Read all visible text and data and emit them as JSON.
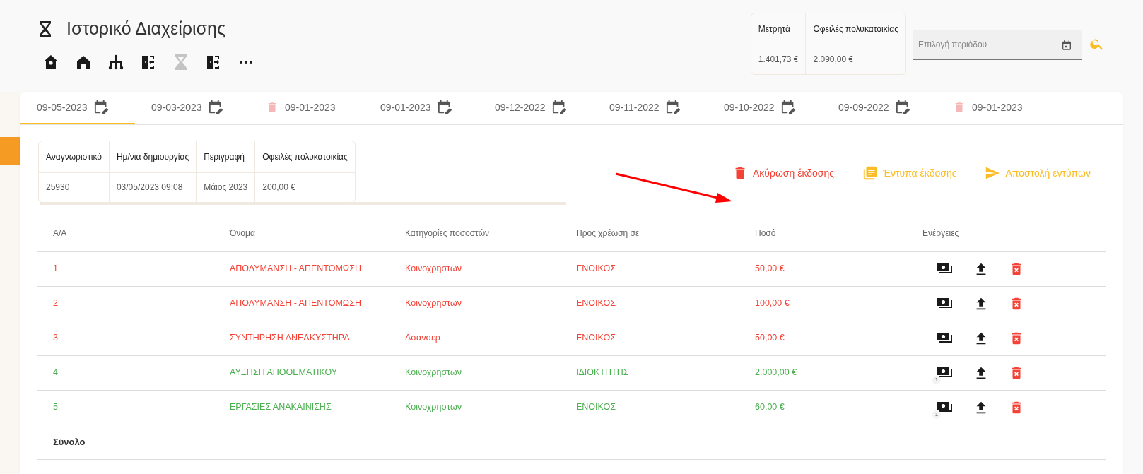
{
  "header": {
    "title": "Ιστορικό Διαχείρισης"
  },
  "toolbar": [
    {
      "kind": "building",
      "selected": false
    },
    {
      "kind": "home",
      "selected": false
    },
    {
      "kind": "tree",
      "selected": false
    },
    {
      "kind": "door-in",
      "selected": false
    },
    {
      "kind": "hourglass",
      "selected": true
    },
    {
      "kind": "door-out",
      "selected": false
    },
    {
      "kind": "more",
      "selected": false
    }
  ],
  "summary": {
    "columns": [
      "Μετρητά",
      "Οφειλές πολυκατοικίας"
    ],
    "values": [
      "1.401,73 €",
      "2.090,00 €"
    ]
  },
  "period_field": {
    "placeholder": "Επιλογή περιόδου"
  },
  "tabs": [
    {
      "label": "09-05-2023",
      "kind": "edit",
      "selected": true
    },
    {
      "label": "09-03-2023",
      "kind": "edit",
      "selected": false
    },
    {
      "label": "09-01-2023",
      "kind": "cancelled",
      "selected": false
    },
    {
      "label": "09-01-2023",
      "kind": "edit",
      "selected": false
    },
    {
      "label": "09-12-2022",
      "kind": "edit",
      "selected": false
    },
    {
      "label": "09-11-2022",
      "kind": "edit",
      "selected": false
    },
    {
      "label": "09-10-2022",
      "kind": "edit",
      "selected": false
    },
    {
      "label": "09-09-2022",
      "kind": "edit",
      "selected": false
    },
    {
      "label": "09-01-2023",
      "kind": "cancelled",
      "selected": false
    }
  ],
  "issue_info": {
    "columns": [
      "Αναγνωριστικό",
      "Ημ/νια δημιουργίας",
      "Περιγραφή",
      "Οφειλές πολυκατοικίας"
    ],
    "values": [
      "25930",
      "03/05/2023 09:08",
      "Μάιος 2023",
      "200,00 €"
    ]
  },
  "actions": [
    {
      "label": "Ακύρωση έκδοσης",
      "kind": "cancel"
    },
    {
      "label": "Έντυπα έκδοσης",
      "kind": "pdf"
    },
    {
      "label": "Αποστολή εντύπων",
      "kind": "send"
    }
  ],
  "table": {
    "columns": [
      "Α/Α",
      "Όνομα",
      "Κατηγορίες ποσοστών",
      "Προς χρέωση σε",
      "Ποσό",
      "Ενέργειες"
    ],
    "rows": [
      {
        "cells": [
          "1",
          "ΑΠΟΛΥΜΑΝΣΗ - ΑΠΕΝΤΟΜΩΣΗ",
          "Κοινοχρηστων",
          "ΕΝΟΙΚΟΣ",
          "50,00 €"
        ],
        "color": "#f44336"
      },
      {
        "cells": [
          "2",
          "ΑΠΟΛΥΜΑΝΣΗ - ΑΠΕΝΤΟΜΩΣΗ",
          "Κοινοχρηστων",
          "ΕΝΟΙΚΟΣ",
          "100,00 €"
        ],
        "color": "#f44336"
      },
      {
        "cells": [
          "3",
          "ΣΥΝΤΗΡΗΣΗ ΑΝΕΛΚΥΣΤΗΡΑ",
          "Ασανσερ",
          "ΕΝΟΙΚΟΣ",
          "50,00 €"
        ],
        "color": "#f44336"
      },
      {
        "cells": [
          "4",
          "ΑΥΞΗΣΗ ΑΠΟΘΕΜΑΤΙΚΟΥ",
          "Κοινοχρηστων",
          "ΙΔΙΟΚΤΗΤΗΣ",
          "2.000,00 €"
        ],
        "color": "#4caf50",
        "badge": "1"
      },
      {
        "cells": [
          "5",
          "ΕΡΓΑΣΙΕΣ ΑΝΑΚΑΙΝΙΣΗΣ",
          "Κοινοχρηστων",
          "ΕΝΟΙΚΟΣ",
          "60,00 €"
        ],
        "color": "#4caf50",
        "badge": "1"
      }
    ],
    "total_label": "Σύνολο"
  }
}
